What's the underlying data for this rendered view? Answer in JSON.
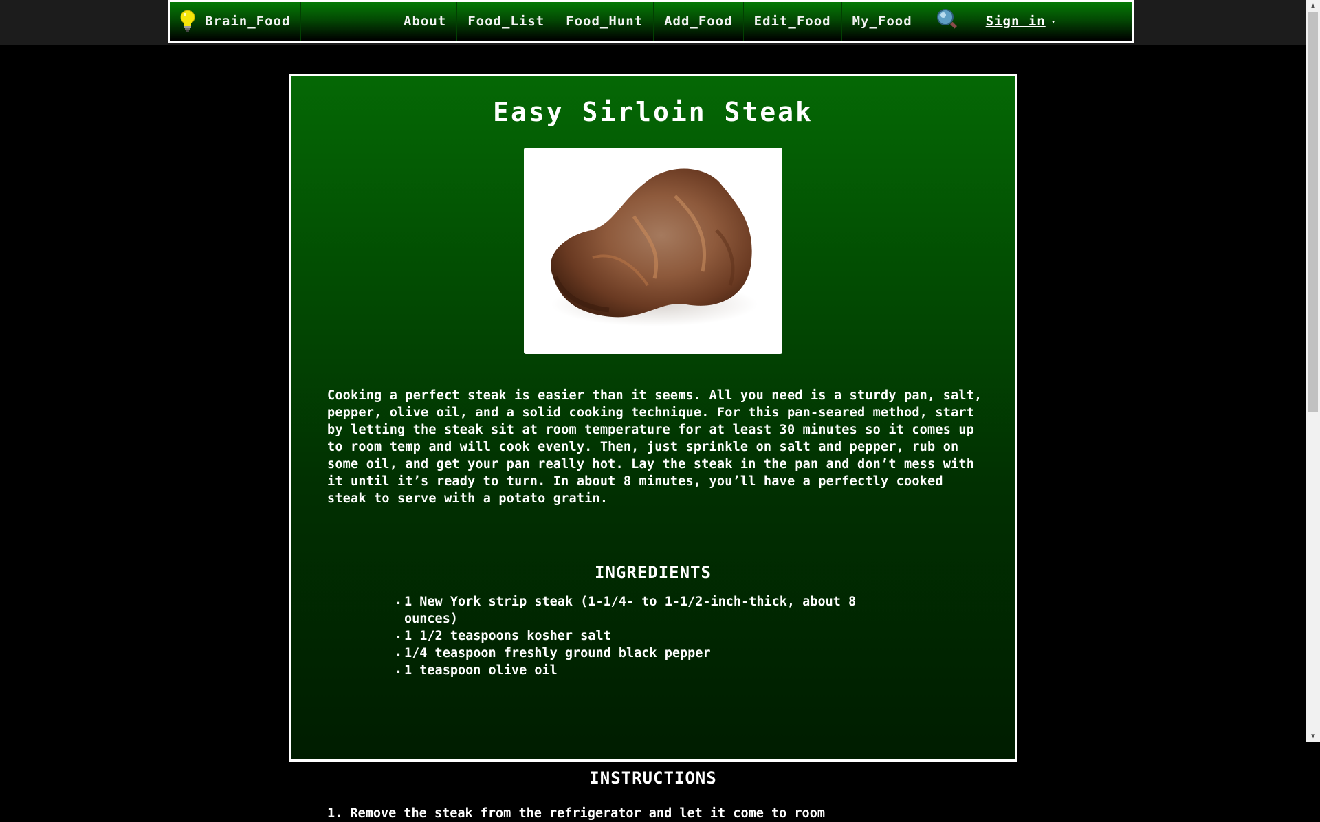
{
  "navbar": {
    "brand": "Brain_Food",
    "items": [
      {
        "label": "About"
      },
      {
        "label": "Food_List"
      },
      {
        "label": "Food_Hunt"
      },
      {
        "label": "Add_Food"
      },
      {
        "label": "Edit_Food"
      },
      {
        "label": "My_Food"
      }
    ],
    "search_icon": "search-icon",
    "signin": "Sign in",
    "signin_caret": "▾"
  },
  "recipe": {
    "title": "Easy Sirloin Steak",
    "image": "steak-photo",
    "description": "Cooking a perfect steak is easier than it seems. All you need is a sturdy pan, salt, pepper, olive oil, and a solid cooking technique. For this pan-seared method, start by letting the steak sit at room temperature for at least 30 minutes so it comes up to room temp and will cook evenly. Then, just sprinkle on salt and pepper, rub on some oil, and get your pan really hot. Lay the steak in the pan and don’t mess with it until it’s ready to turn. In about 8 minutes, you’ll have a perfectly cooked steak to serve with a potato gratin.",
    "ingredients_heading": "INGREDIENTS",
    "ingredients": [
      "1 New York strip steak (1-1/4- to 1-1/2-inch-thick, about 8 ounces)",
      "1 1/2 teaspoons kosher salt",
      "1/4 teaspoon freshly ground black pepper",
      "1 teaspoon olive oil"
    ],
    "instructions_heading": "INSTRUCTIONS",
    "instructions": [
      "1. Remove the steak from the refrigerator and let it come to room"
    ]
  },
  "colors": {
    "nav_green": "#057a05",
    "card_green": "#056805",
    "background": "#000000",
    "bulb_yellow": "#f5e60a"
  }
}
